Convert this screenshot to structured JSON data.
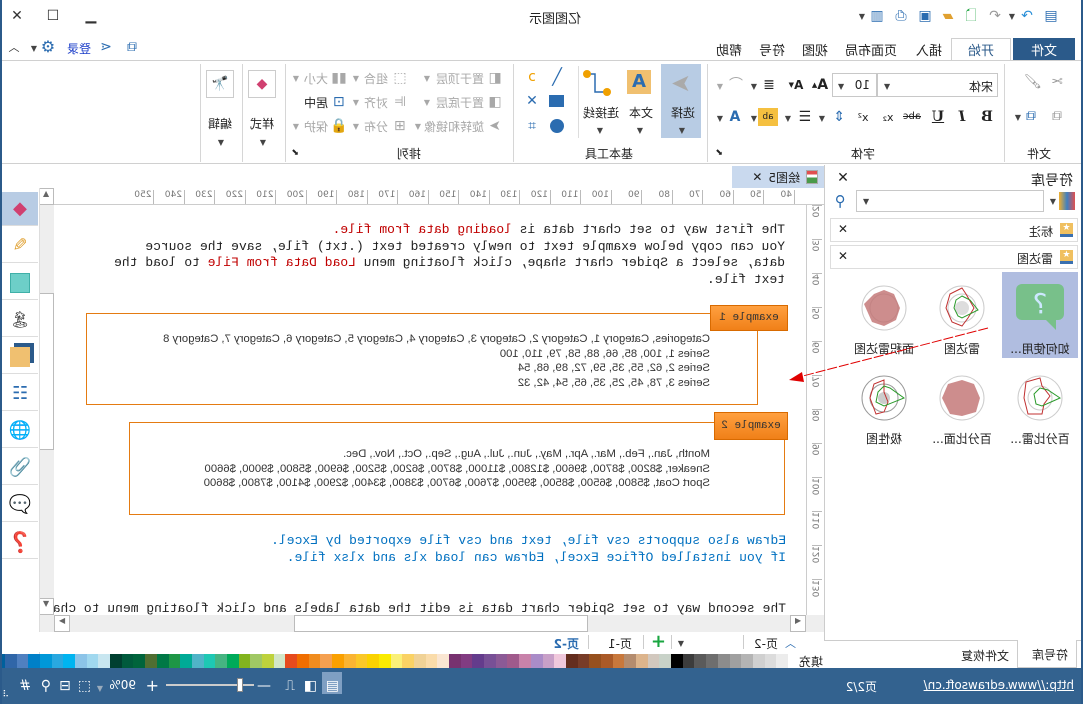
{
  "window": {
    "title": "亿图图示",
    "minimize_icon": "minimize-icon",
    "maximize_icon": "maximize-icon",
    "close_icon": "close-icon"
  },
  "quick_access": [
    "file-icon",
    "redo-icon",
    "undo-icon",
    "new-icon",
    "open-icon",
    "save-icon",
    "print-icon",
    "export-icon",
    "more-icon"
  ],
  "menu_tabs": [
    {
      "label": "文件",
      "active": false,
      "accent": true
    },
    {
      "label": "开始",
      "active": true
    },
    {
      "label": "插入"
    },
    {
      "label": "页面布局"
    },
    {
      "label": "视图"
    },
    {
      "label": "符号"
    },
    {
      "label": "帮助"
    }
  ],
  "account": {
    "login_label": "登录"
  },
  "ribbon": {
    "file_group": {
      "label": "文件"
    },
    "font_group": {
      "label": "字体",
      "font_name": "宋体",
      "font_size": "10",
      "bold": "B",
      "italic": "I",
      "underline": "U",
      "strike": "abc",
      "subscript": "x₂",
      "superscript": "x²",
      "highlight": "ab",
      "font_color": "A",
      "grow": "A",
      "shrink": "A"
    },
    "tools_group": {
      "label": "基本工具",
      "select": "选择",
      "text": "文本",
      "connector": "连接线"
    },
    "arrange_group": {
      "label": "排列",
      "bring_front": "置于顶层",
      "send_back": "置于底层",
      "rotate": "旋转和镜像",
      "group": "组合",
      "align": "对齐",
      "distribute": "分布",
      "size": "大小",
      "center": "居中",
      "protect": "保护"
    },
    "style_group": {
      "label": "样式"
    },
    "edit_group": {
      "label": "编辑"
    }
  },
  "library": {
    "title": "符号库",
    "search_placeholder": "",
    "categories": [
      {
        "label": "标注"
      },
      {
        "label": "雷达图"
      }
    ],
    "symbols": [
      {
        "label": "如何使用...",
        "selected": true
      },
      {
        "label": "雷达图"
      },
      {
        "label": "面积雷达图"
      },
      {
        "label": "百分比雷..."
      },
      {
        "label": "百分比面..."
      },
      {
        "label": "极性图"
      }
    ],
    "bottom_tabs": [
      {
        "label": "符号库",
        "active": true
      },
      {
        "label": "文件恢复"
      }
    ]
  },
  "document": {
    "tab_label": "绘图5",
    "ruler_h": [
      "40",
      "50",
      "60",
      "70",
      "80",
      "90",
      "100",
      "110",
      "120",
      "130",
      "140",
      "150",
      "160",
      "170",
      "180",
      "190",
      "200",
      "210",
      "220",
      "230",
      "240",
      "250"
    ],
    "ruler_v": [
      "20",
      "30",
      "40",
      "50",
      "60",
      "70",
      "80",
      "90",
      "100",
      "110",
      "120",
      "130"
    ],
    "para1": {
      "l1a": "The first way to set chart data is ",
      "l1b": "loading data from file.",
      "l2": "You can copy below example text to newly created text (.txt) file, save the source",
      "l3a": "data, select a Spider chart shape, click floating menu ",
      "l3b": "Load Data from File",
      "l3c": " to load the",
      "l4": "text file."
    },
    "example1": {
      "label": "example 1",
      "lines": [
        "Categories, Category 1, Category 2, Category 3, Category 4, Category 5, Category 6, Category 7, Category 8",
        "Series 1, 100, 85, 66, 88, 58, 79, 110, 100",
        "Series 2, 62, 55, 35, 59, 72, 89, 68, 54",
        "Series 3, 78, 45, 25, 35, 65, 54, 42, 32"
      ]
    },
    "example2": {
      "label": "example 2",
      "lines": [
        "Month, Jan., Feb., Mar., Apr., May., Jun., Jul., Aug., Sep., Oct., Nov., Dec.",
        "Sneaker, $8200, $8700, $9600, $12800, $11000, $8700, $6200, $5200, $6900, $5800, $9000, $6600",
        "Sport Coat, $5800, $6500, $8500, $9500, $7600, $6700, $3800, $3400, $2900, $4100, $7800, $8600"
      ]
    },
    "para2": {
      "l1": "Edraw also supports csv file, text and csv file exported by Excel.",
      "l2": "If you installed Office Excel, Edraw can load xls and xlsx file."
    },
    "para3": "The second way to set Spider chart data is edit the data labels and click floating menu to change"
  },
  "pages": {
    "current_label": "页-2",
    "tabs": [
      {
        "label": "页-1"
      },
      {
        "label": "页-2",
        "active": true
      }
    ]
  },
  "fill": {
    "label": "填充",
    "colors": [
      "#b40a14",
      "#d20a1e",
      "#c85078",
      "#dc5a6e",
      "#eb6e78",
      "#e664a0",
      "#e68caa",
      "#f08c8c",
      "#f5a078",
      "#f0aa96",
      "#f5bebe",
      "#e6d2e6",
      "#fadce6",
      "#fad2dc",
      "#1e2850",
      "#283c6e",
      "#3c3280",
      "#1e4a8c",
      "#00609c",
      "#3066a8",
      "#5080c0",
      "#0080c8",
      "#0098d8",
      "#29a8e0",
      "#00b4f0",
      "#8cc4e8",
      "#a0d8ef",
      "#c8e6f0",
      "#003f30",
      "#005a3c",
      "#00643c",
      "#506e32",
      "#007846",
      "#1e9646",
      "#00aa96",
      "#50b4c8",
      "#1ec8b4",
      "#46b482",
      "#00aa5a",
      "#82b41e",
      "#a0c864",
      "#bed23c",
      "#d2e6c8",
      "#e64b1e",
      "#f06e00",
      "#f08c1e",
      "#f5a050",
      "#faa000",
      "#fab432",
      "#fac828",
      "#fad200",
      "#faeb00",
      "#faf078",
      "#fad264",
      "#f0d296",
      "#fadcaa",
      "#fae6d2",
      "#783270",
      "#823c82",
      "#643c8c",
      "#785096",
      "#8c5a96",
      "#a05a8c",
      "#c882aa",
      "#aa8cc8",
      "#c8a0c8",
      "#f0c8dc",
      "#642d1e",
      "#783c28",
      "#96501e",
      "#aa5a28",
      "#c8783c",
      "#b48c6e",
      "#dcb48c",
      "#d2c8be",
      "#c8d2c8",
      "#000000",
      "#3c3c3c",
      "#5a5a5a",
      "#6e6e6e",
      "#8c8c8c",
      "#a0a0a0",
      "#b4b4b4",
      "#d0d0d0",
      "#dcdcdc",
      "#ececec"
    ]
  },
  "status": {
    "link": "http://www.edrawsoft.cn/",
    "page_info": "页2/2",
    "zoom_label": "90%",
    "zoom_percent": 90
  },
  "colors": {
    "accent": "#2b5a8a",
    "status_bar": "#33628f",
    "selected": "#b8cce4",
    "example_border": "#e47b12"
  }
}
